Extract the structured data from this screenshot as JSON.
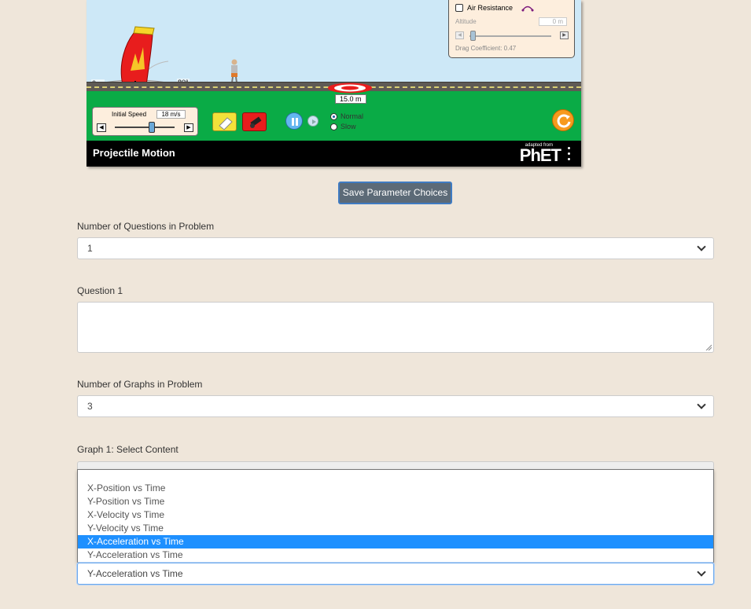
{
  "simulation": {
    "title": "Projectile Motion",
    "brand": "PhET",
    "brand_prefix": "adapted from",
    "angle_zero": "0 m",
    "angle_label": "80°",
    "target_distance": "15.0 m",
    "speed_label": "Initial Speed",
    "speed_value": "18 m/s",
    "speed_fraction": 0.66,
    "speed_left_arrow": "◀",
    "speed_right_arrow": "▶",
    "speed_labels": {
      "normal": "Normal",
      "slow": "Slow"
    },
    "speed_selected": "Normal",
    "air": {
      "checkbox_label": "Air Resistance",
      "checked": false,
      "altitude_label": "Altitude",
      "altitude_value": "0 m",
      "altitude_fraction": 0.0,
      "drag_label": "Drag Coefficient: 0.47",
      "left_arrow": "◀",
      "right_arrow": "▶"
    },
    "colors": {
      "sky": "#cde8f7",
      "grass": "#0aab46",
      "cannon": "#e81d1d",
      "reset": "#f79a1d"
    }
  },
  "form": {
    "save_button": "Save Parameter Choices",
    "questions_label": "Number of Questions in Problem",
    "questions_value": "1",
    "question1_label": "Question 1",
    "question1_value": "",
    "graphs_label": "Number of Graphs in Problem",
    "graphs_value": "3",
    "graph1_label": "Graph 1: Select Content",
    "graph_select_value": "Y-Acceleration vs Time",
    "dropdown_options": [
      "X-Position vs Time",
      "Y-Position vs Time",
      "X-Velocity vs Time",
      "Y-Velocity vs Time",
      "X-Acceleration vs Time",
      "Y-Acceleration vs Time"
    ],
    "dropdown_highlighted": "X-Acceleration vs Time"
  }
}
